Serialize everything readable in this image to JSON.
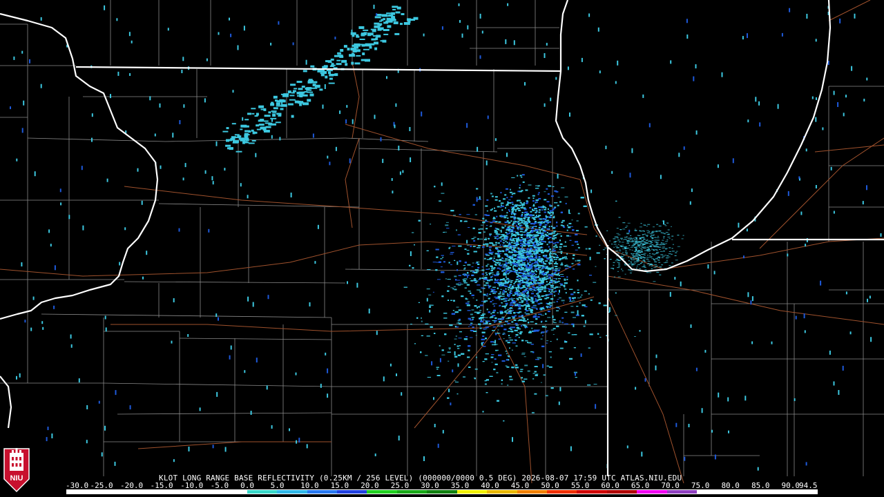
{
  "title_line": "KLOT LONG RANGE BASE REFLECTIVITY (0.25KM / 256 LEVEL) (000000/0000 0.5 DEG) 2026-08-07 17:59 UTC  ATLAS.NIU.EDU",
  "logo_text": "NIU",
  "colors": {
    "background": "#000000",
    "state_border": "#ffffff",
    "county_border": "#8a8a8a",
    "highway": "#a0522d",
    "echo_light": "#3cc8e0",
    "echo_dark": "#1e5adc",
    "radar_site": "#000000",
    "logo_red": "#c8102e"
  },
  "scale": {
    "labels": [
      "-30.0",
      "-25.0",
      "-20.0",
      "-15.0",
      "-10.0",
      "-5.0",
      "0.0",
      "5.0",
      "10.0",
      "15.0",
      "20.0",
      "25.0",
      "30.0",
      "35.0",
      "40.0",
      "45.0",
      "50.0",
      "55.0",
      "60.0",
      "65.0",
      "70.0",
      "75.0",
      "80.0",
      "85.0",
      "90.0",
      "94.5"
    ],
    "colors": [
      "#ffffff",
      "#ffffff",
      "#ffffff",
      "#ffffff",
      "#ffffff",
      "#ffffff",
      "#38d7c8",
      "#30b8e8",
      "#2878f0",
      "#2040e0",
      "#20d020",
      "#18a818",
      "#108010",
      "#f0f000",
      "#e8b800",
      "#f08000",
      "#f03000",
      "#d00000",
      "#b00000",
      "#f000f0",
      "#9040c0",
      "#ffffff",
      "#ffffff",
      "#ffffff",
      "#ffffff"
    ]
  }
}
